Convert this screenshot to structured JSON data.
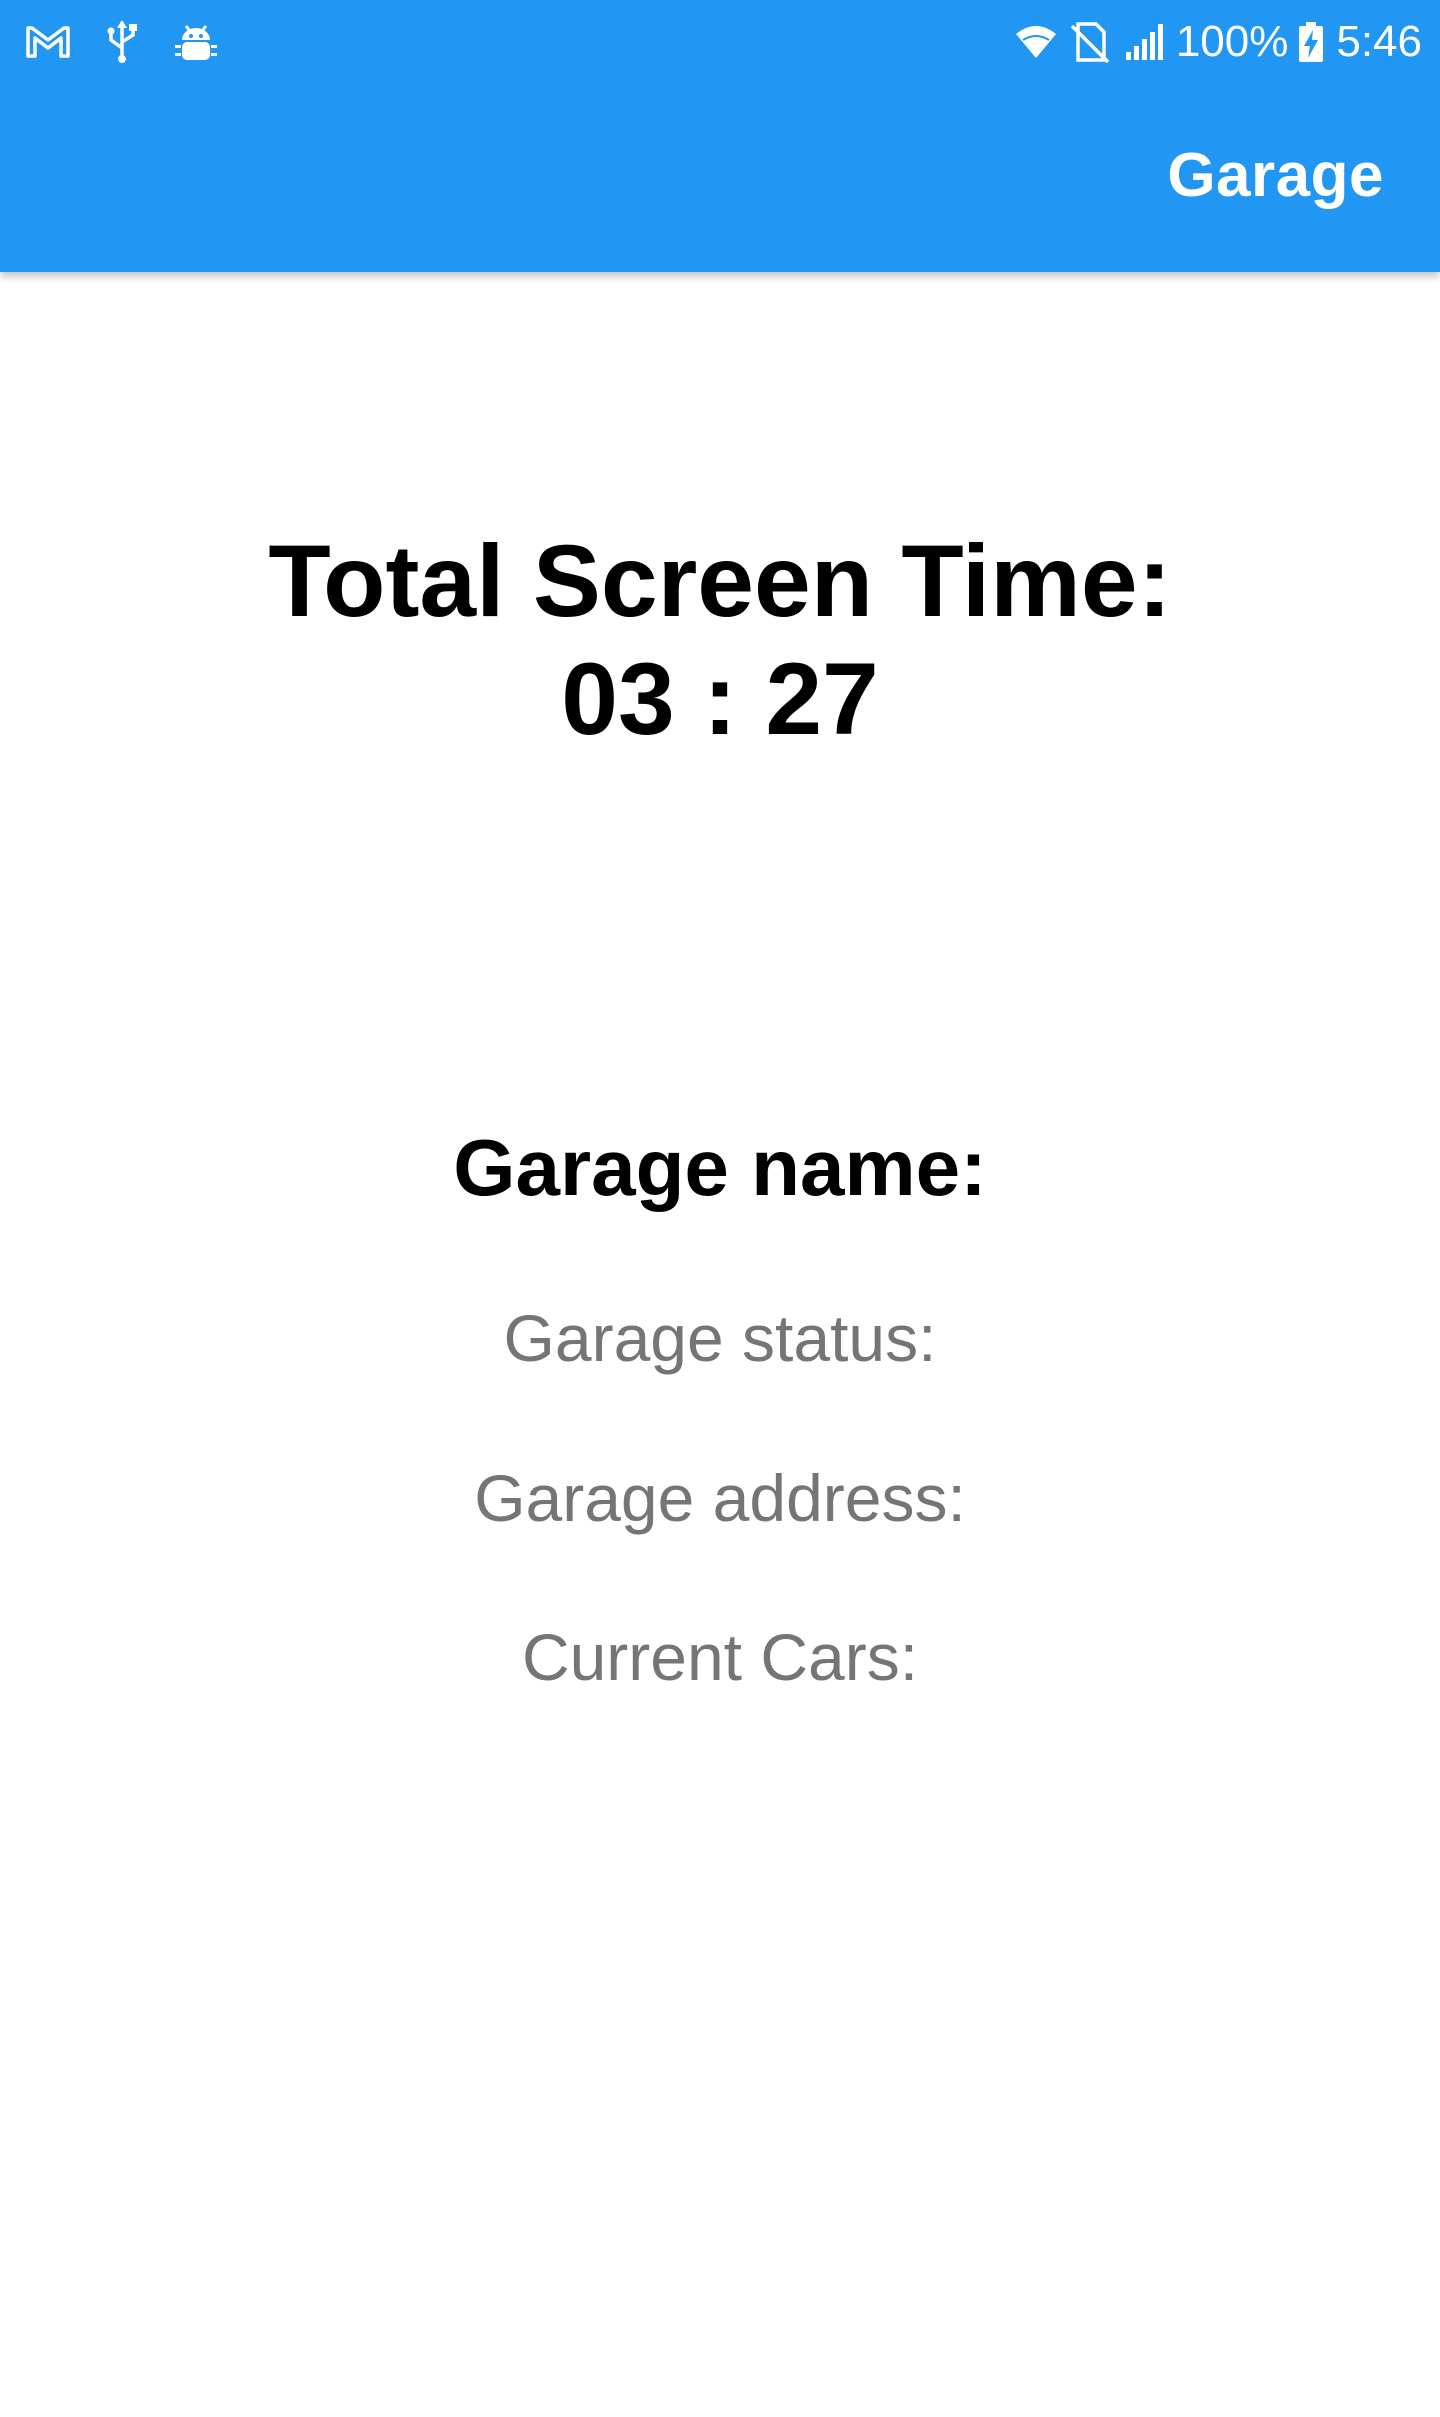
{
  "status_bar": {
    "left_icons": [
      "gmail-icon",
      "usb-icon",
      "android-debug-icon"
    ],
    "right_icons": [
      "wifi-icon",
      "no-sim-icon",
      "signal-icon",
      "battery-charging-icon"
    ],
    "battery": "100%",
    "time": "5:46"
  },
  "app_bar": {
    "title": "Garage",
    "color": "#2196F3"
  },
  "screen_time": {
    "label": "Total Screen Time:",
    "value": "03 : 27"
  },
  "garage": {
    "name_label": "Garage name:",
    "status_label": "Garage status:",
    "address_label": "Garage address:",
    "cars_label": "Current Cars:"
  },
  "colors": {
    "primary": "#2196F3",
    "secondary_text": "#757575"
  }
}
